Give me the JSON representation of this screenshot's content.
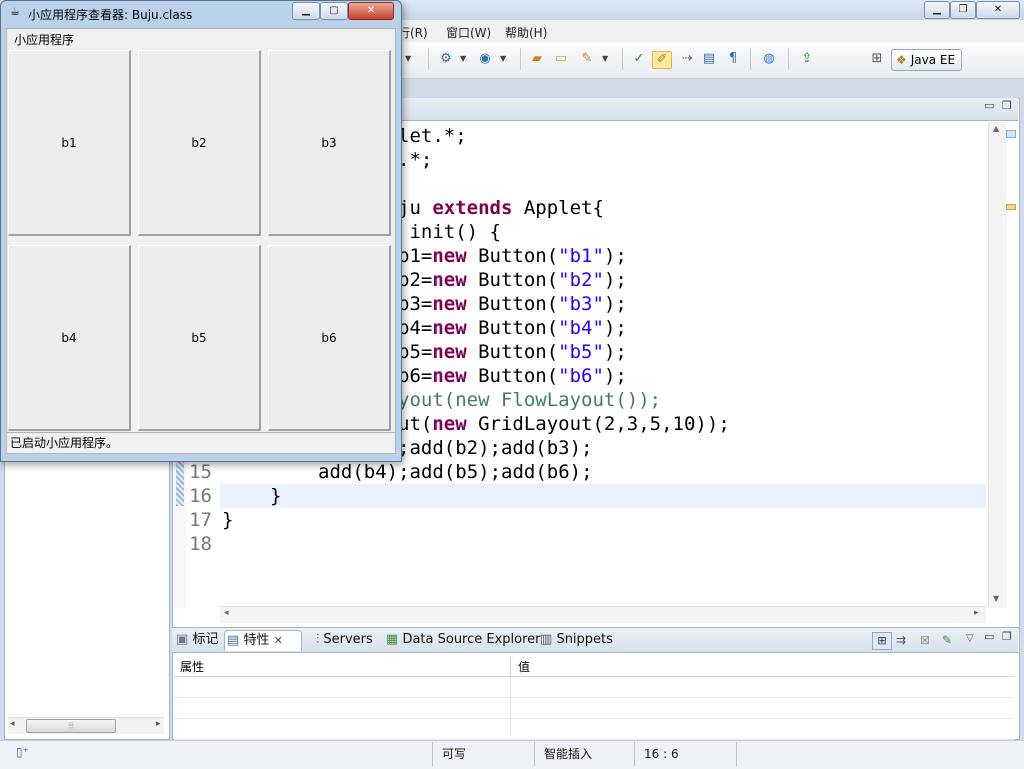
{
  "eclipse": {
    "title_fragment": "",
    "menus": [
      {
        "label": "行(R)"
      },
      {
        "label": "窗口(W)"
      },
      {
        "label": "帮助(H)"
      }
    ],
    "perspective": "Java EE"
  },
  "editor": {
    "lines": [
      {
        "num": "",
        "code": "let.*;"
      },
      {
        "num": "",
        "code": ".*;"
      },
      {
        "num": "",
        "code": ""
      },
      {
        "num": "",
        "code": "ju extends Applet{"
      },
      {
        "num": "",
        "code": " init() {"
      },
      {
        "num": "",
        "code": "b1=new Button(\"b1\");"
      },
      {
        "num": "",
        "code": "b2=new Button(\"b2\");"
      },
      {
        "num": "",
        "code": "b3=new Button(\"b3\");"
      },
      {
        "num": "",
        "code": "b4=new Button(\"b4\");"
      },
      {
        "num": "",
        "code": "b5=new Button(\"b5\");"
      },
      {
        "num": "",
        "code": "b6=new Button(\"b6\");"
      },
      {
        "num": "",
        "code": "yout(new FlowLayout());"
      },
      {
        "num": "",
        "code": "ut(new GridLayout(2,3,5,10));"
      },
      {
        "num": "",
        "code": ";add(b2);add(b3);"
      },
      {
        "num": "15",
        "code": "add(b4);add(b5);add(b6);"
      },
      {
        "num": "16",
        "code": "}"
      },
      {
        "num": "17",
        "code": "}"
      },
      {
        "num": "18",
        "code": ""
      }
    ]
  },
  "bottom_view": {
    "tabs": [
      {
        "label": "标记"
      },
      {
        "label": "特性"
      },
      {
        "label": "Servers"
      },
      {
        "label": "Data Source Explorer"
      },
      {
        "label": "Snippets"
      }
    ],
    "columns": [
      "属性",
      "值"
    ]
  },
  "status": {
    "mode": "可写",
    "insert": "智能插入",
    "position": "16 : 6"
  },
  "applet": {
    "title": "小应用程序查看器: Buju.class",
    "menu": "小应用程序",
    "buttons": [
      "b1",
      "b2",
      "b3",
      "b4",
      "b5",
      "b6"
    ],
    "status": "已启动小应用程序。"
  }
}
